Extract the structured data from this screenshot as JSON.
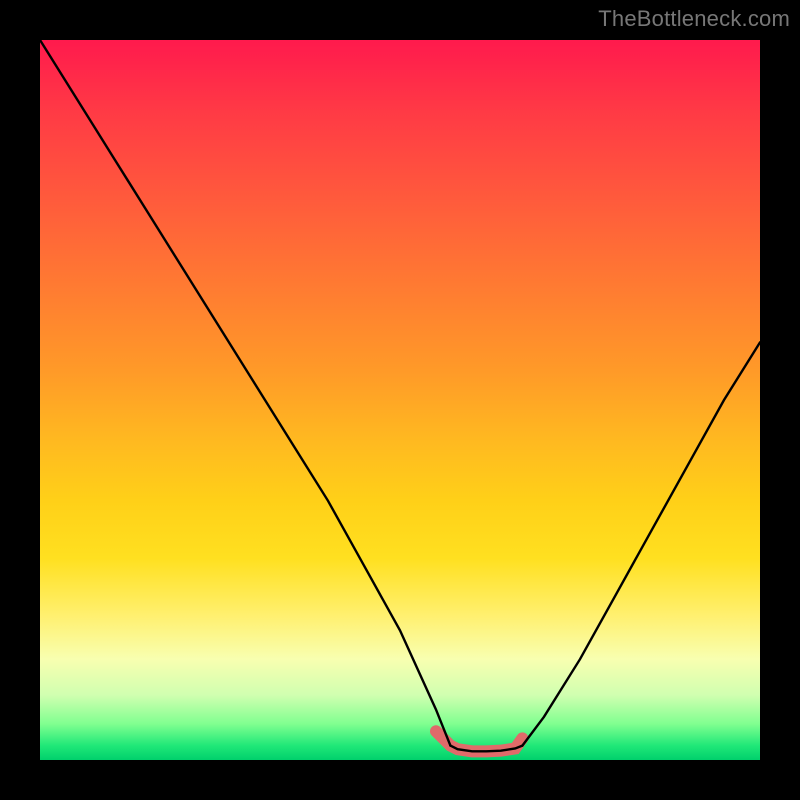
{
  "watermark": "TheBottleneck.com",
  "colors": {
    "frame": "#000000",
    "watermark_text": "#777777",
    "curve": "#000000",
    "accent": "#e06a6a",
    "gradient_top": "#ff1a4d",
    "gradient_bottom": "#00d06c"
  },
  "chart_data": {
    "type": "line",
    "title": "",
    "xlabel": "",
    "ylabel": "",
    "xlim": [
      0,
      100
    ],
    "ylim": [
      0,
      100
    ],
    "grid": false,
    "legend": false,
    "series": [
      {
        "name": "left-curve",
        "x": [
          0,
          5,
          10,
          15,
          20,
          25,
          30,
          35,
          40,
          45,
          50,
          55,
          57
        ],
        "values": [
          100,
          92,
          84,
          76,
          68,
          60,
          52,
          44,
          36,
          27,
          18,
          7,
          2
        ]
      },
      {
        "name": "flat-segment",
        "x": [
          57,
          58,
          60,
          62,
          64,
          66,
          67
        ],
        "values": [
          2,
          1.5,
          1.2,
          1.2,
          1.3,
          1.6,
          2
        ]
      },
      {
        "name": "right-curve",
        "x": [
          67,
          70,
          75,
          80,
          85,
          90,
          95,
          100
        ],
        "values": [
          2,
          6,
          14,
          23,
          32,
          41,
          50,
          58
        ]
      },
      {
        "name": "accent-highlight",
        "x": [
          55,
          56,
          57,
          58,
          60,
          62,
          64,
          66,
          67
        ],
        "values": [
          4,
          3,
          2,
          1.5,
          1.2,
          1.2,
          1.3,
          1.6,
          3
        ]
      }
    ],
    "annotations": []
  }
}
